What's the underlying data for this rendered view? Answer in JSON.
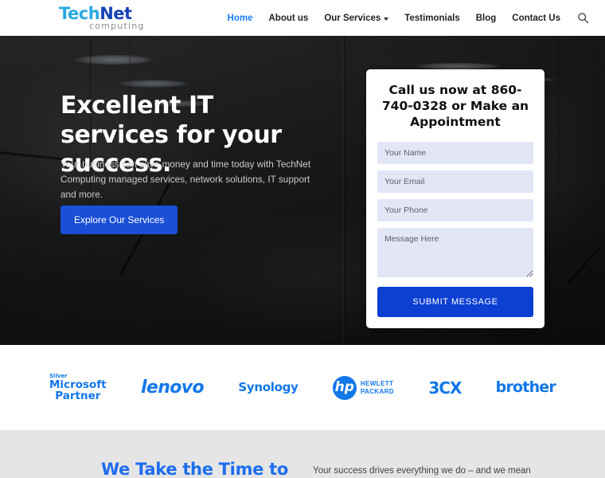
{
  "header": {
    "logo": {
      "part1": "Tech",
      "part2": "Net",
      "sub": "computing",
      "color1": "#27a9e1",
      "color2": "#1543b5"
    },
    "nav": [
      {
        "label": "Home",
        "active": true
      },
      {
        "label": "About us",
        "active": false
      },
      {
        "label": "Our Services",
        "active": false,
        "has_dropdown": true
      },
      {
        "label": "Testimonials",
        "active": false
      },
      {
        "label": "Blog",
        "active": false
      },
      {
        "label": "Contact Us",
        "active": false
      }
    ],
    "search_icon": "search-icon",
    "active_color": "#1b7ef7"
  },
  "hero": {
    "title": "Excellent IT services for your success.",
    "subtitle": "Your business can save money and time today with TechNet Computing managed services, network solutions, IT support and more.",
    "cta_label": "Explore Our Services",
    "cta_color": "#1a4fd6"
  },
  "form": {
    "title": "Call us now at 860-740-0328 or Make an Appointment",
    "phone": "860-740-0328",
    "fields": [
      {
        "name": "your-name",
        "placeholder": "Your Name",
        "value": ""
      },
      {
        "name": "your-email",
        "placeholder": "Your Email",
        "value": ""
      },
      {
        "name": "your-phone",
        "placeholder": "Your Phone",
        "value": ""
      }
    ],
    "message_placeholder": "Message Here",
    "submit_label": "SUBMIT MESSAGE",
    "submit_color": "#0d3fd3",
    "field_bg": "#e2e6f7"
  },
  "partners": {
    "brand_color": "#1277e8",
    "items": [
      {
        "name": "microsoft-partner",
        "tier": "Silver",
        "line1": "Microsoft",
        "line2": "Partner"
      },
      {
        "name": "lenovo",
        "label": "lenovo"
      },
      {
        "name": "synology",
        "label": "Synology"
      },
      {
        "name": "hewlett-packard",
        "mark": "hp",
        "line1": "HEWLETT",
        "line2": "PACKARD"
      },
      {
        "name": "3cx",
        "label": "3CX"
      },
      {
        "name": "brother",
        "label": "brother"
      }
    ]
  },
  "about": {
    "heading": "We Take the Time to",
    "heading_color": "#1e6ef0",
    "body": "Your success drives everything we do – and we mean"
  }
}
